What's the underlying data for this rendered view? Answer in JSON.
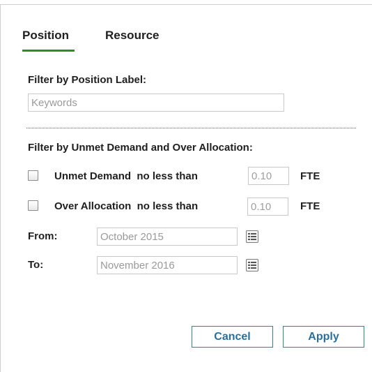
{
  "tabs": {
    "position": "Position",
    "resource": "Resource"
  },
  "position_filter": {
    "label": "Filter by Position Label:",
    "placeholder": "Keywords"
  },
  "demand_filter": {
    "section_label": "Filter by Unmet Demand and Over Allocation:",
    "unmet_label": "Unmet Demand  no less than",
    "unmet_value": "0.10",
    "unmet_unit": "FTE",
    "over_label": "Over Allocation  no less than",
    "over_value": "0.10",
    "over_unit": "FTE",
    "from_label": "From:",
    "from_value": "October 2015",
    "to_label": "To:",
    "to_value": "November 2016"
  },
  "buttons": {
    "cancel": "Cancel",
    "apply": "Apply"
  },
  "colors": {
    "tab_underline": "#2e8b2e",
    "button_border": "#2e8b7a",
    "button_text": "#2a6f9b"
  },
  "icons": {
    "calendar": "calendar-list-icon"
  }
}
